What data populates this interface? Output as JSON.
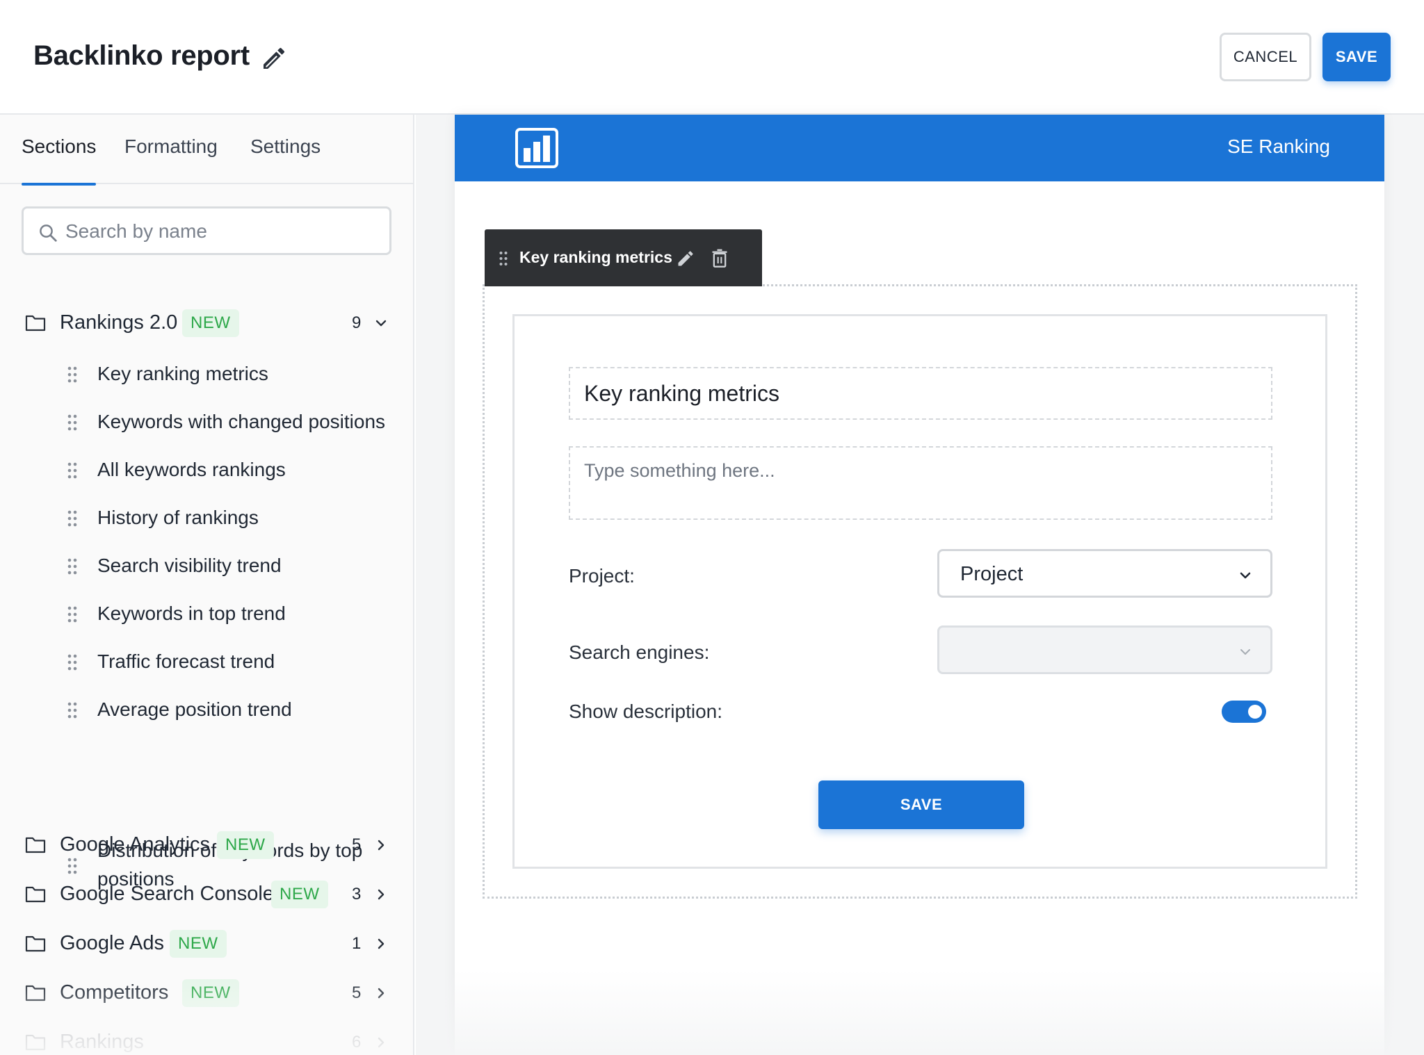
{
  "header": {
    "title": "Backlinko report",
    "edit_icon": "pencil-icon",
    "cancel_label": "CANCEL",
    "save_label": "SAVE"
  },
  "sidebar": {
    "tabs": [
      {
        "label": "Sections",
        "active": true
      },
      {
        "label": "Formatting",
        "active": false
      },
      {
        "label": "Settings",
        "active": false
      }
    ],
    "search": {
      "placeholder": "Search by name",
      "value": ""
    },
    "new_badge": "NEW",
    "groups": [
      {
        "label": "Rankings 2.0",
        "badge": "NEW",
        "count": "9",
        "expanded": true,
        "items": [
          "Key ranking metrics",
          "Keywords with changed positions",
          "All keywords rankings",
          "History of rankings",
          "Search visibility trend",
          "Keywords in top trend",
          "Traffic forecast trend",
          "Average position trend",
          "Distribution of keywords by top positions"
        ]
      },
      {
        "label": "Google Analytics",
        "badge": "NEW",
        "count": "5",
        "expanded": false
      },
      {
        "label": "Google Search Console",
        "badge": "NEW",
        "count": "3",
        "expanded": false
      },
      {
        "label": "Google Ads",
        "badge": "NEW",
        "count": "1",
        "expanded": false
      },
      {
        "label": "Competitors",
        "badge": "NEW",
        "count": "5",
        "expanded": false
      },
      {
        "label": "Rankings",
        "badge": "",
        "count": "6",
        "expanded": false
      }
    ]
  },
  "report": {
    "brand_name": "SE Ranking",
    "toolbar_label": "Key ranking metrics",
    "section": {
      "title_value": "Key ranking metrics",
      "description_placeholder": "Type something here...",
      "project_label": "Project:",
      "project_value": "Project",
      "engines_label": "Search engines:",
      "engines_value": "",
      "show_description_label": "Show description:",
      "show_description": true,
      "save_label": "SAVE"
    }
  },
  "colors": {
    "accent": "#1b74d6",
    "badge_bg": "#e6f6ea",
    "badge_text": "#2ea84a",
    "toolbar_bg": "#2f3134"
  }
}
